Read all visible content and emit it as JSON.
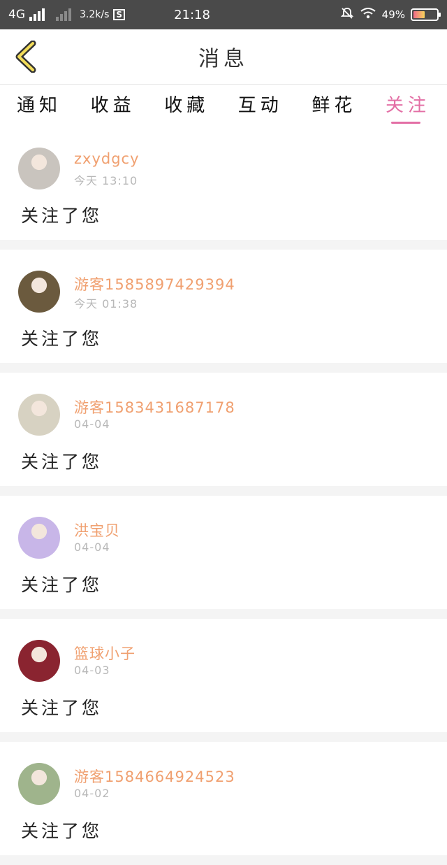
{
  "status_bar": {
    "network": "4G",
    "speed": "3.2k/s",
    "s_icon": "S",
    "time": "21:18",
    "battery": "49%",
    "battery_level_fraction": 0.49
  },
  "header": {
    "title": "消息"
  },
  "tabs": [
    {
      "label": "通知",
      "active": false
    },
    {
      "label": "收益",
      "active": false
    },
    {
      "label": "收藏",
      "active": false
    },
    {
      "label": "互动",
      "active": false
    },
    {
      "label": "鲜花",
      "active": false
    },
    {
      "label": "关注",
      "active": true
    }
  ],
  "messages": [
    {
      "name": "zxydgcy",
      "time": "今天 13:10",
      "text": "关注了您",
      "avatar_color": "#c9c4be"
    },
    {
      "name": "游客1585897429394",
      "time": "今天 01:38",
      "text": "关注了您",
      "avatar_color": "#6b5a3e"
    },
    {
      "name": "游客1583431687178",
      "time": "04-04",
      "text": "关注了您",
      "avatar_color": "#d7d2c2"
    },
    {
      "name": "洪宝贝",
      "time": "04-04",
      "text": "关注了您",
      "avatar_color": "#c8b6e8"
    },
    {
      "name": "篮球小子",
      "time": "04-03",
      "text": "关注了您",
      "avatar_color": "#8a2430"
    },
    {
      "name": "游客1584664924523",
      "time": "04-02",
      "text": "关注了您",
      "avatar_color": "#9fb48c"
    }
  ],
  "colors": {
    "accent": "#e36fa5",
    "username": "#f0a070",
    "status_bar": "#4a4a4a"
  }
}
